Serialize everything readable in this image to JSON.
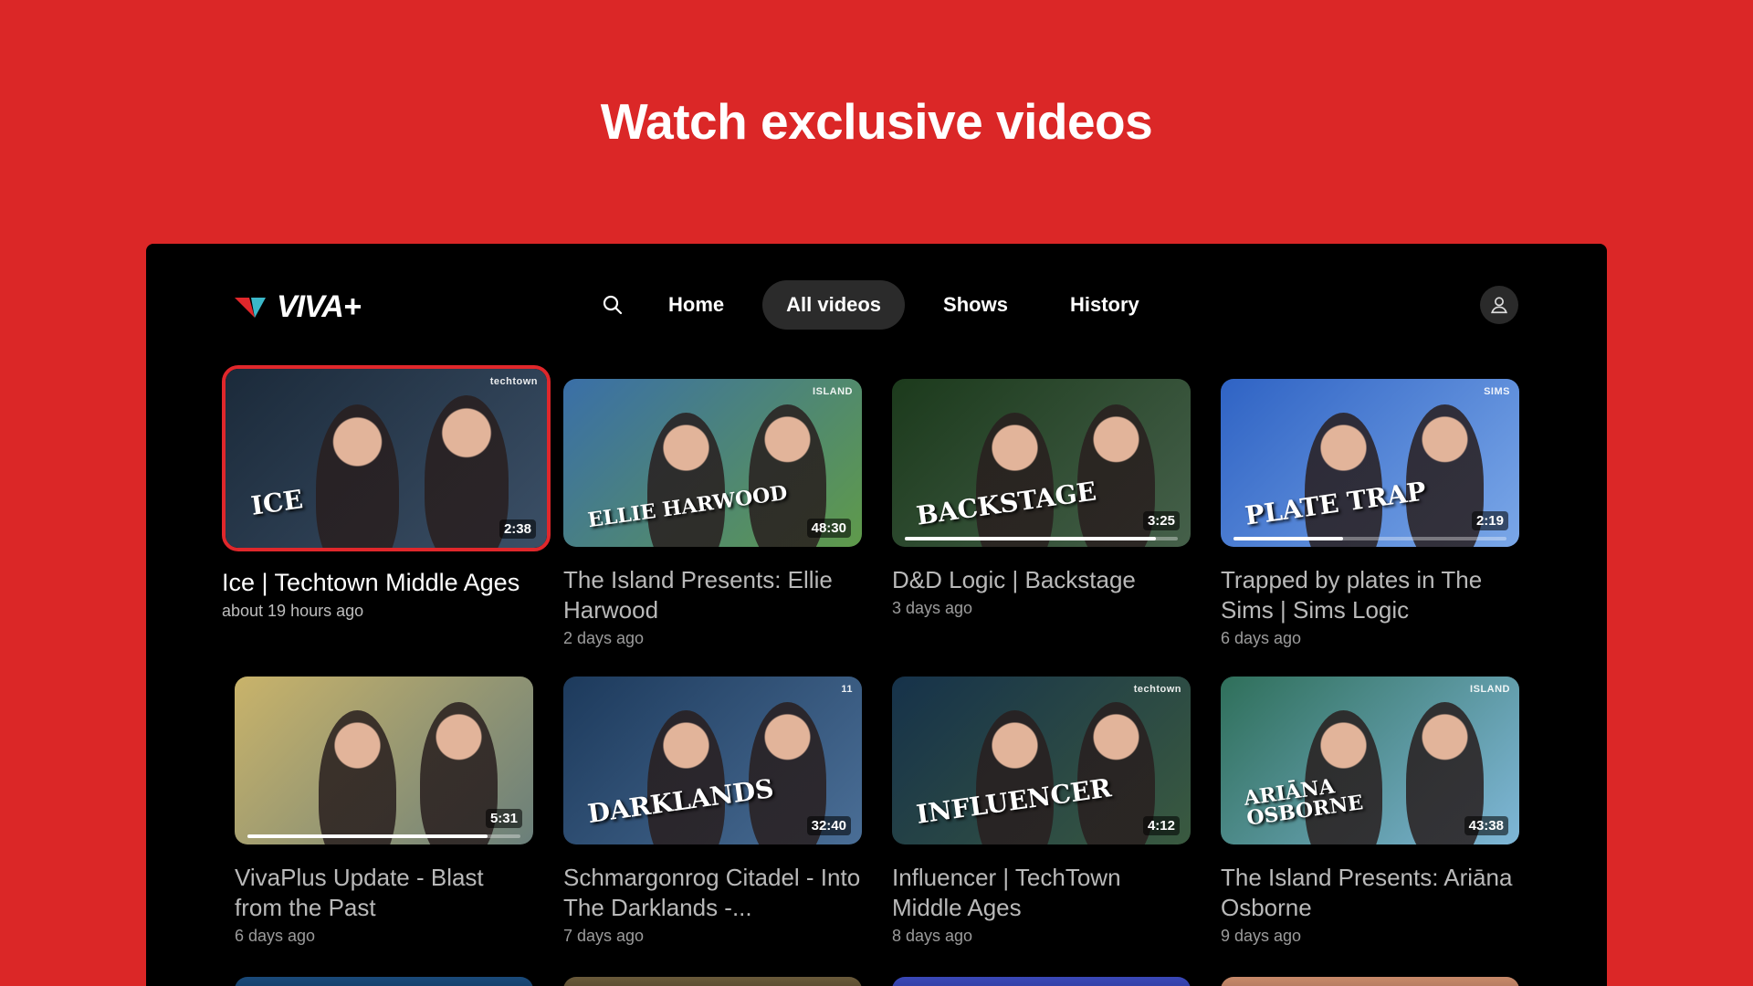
{
  "headline": "Watch exclusive videos",
  "app": {
    "logo_text": "VIVA+"
  },
  "nav": {
    "search_icon": "search-icon",
    "items": [
      {
        "label": "Home",
        "active": false
      },
      {
        "label": "All videos",
        "active": true
      },
      {
        "label": "Shows",
        "active": false
      },
      {
        "label": "History",
        "active": false
      }
    ],
    "profile_icon": "user-icon"
  },
  "videos": [
    {
      "title": "Ice | Techtown Middle Ages",
      "meta": "about 19 hours ago",
      "duration": "2:38",
      "overlay": "ICE",
      "brand": "techtown",
      "progress": 0,
      "colors": [
        "#1b2a3a",
        "#3b4f66"
      ]
    },
    {
      "title": "The Island Presents: Ellie Harwood",
      "meta": "2 days ago",
      "duration": "48:30",
      "overlay": "ELLIE HARWOOD",
      "brand": "ISLAND",
      "progress": 0,
      "colors": [
        "#3a6fa8",
        "#5f9a4a"
      ]
    },
    {
      "title": "D&D Logic | Backstage",
      "meta": "3 days ago",
      "duration": "3:25",
      "overlay": "BACKSTAGE",
      "brand": "",
      "progress": 0.92,
      "colors": [
        "#1c3a1c",
        "#45604a"
      ]
    },
    {
      "title": "Trapped by plates in The Sims | Sims Logic",
      "meta": "6 days ago",
      "duration": "2:19",
      "overlay": "PLATE TRAP",
      "brand": "SIMS",
      "progress": 0.4,
      "colors": [
        "#2f63c4",
        "#7aa7e8"
      ]
    },
    {
      "title": "VivaPlus Update - Blast from the Past",
      "meta": "6 days ago",
      "duration": "5:31",
      "overlay": "",
      "brand": "",
      "progress": 0.88,
      "colors": [
        "#c9b36a",
        "#6a7f7a"
      ]
    },
    {
      "title": "Schmargonrog Citadel - Into The Darklands -...",
      "meta": "7 days ago",
      "duration": "32:40",
      "overlay": "DARKLANDS",
      "brand": "11",
      "progress": 0,
      "colors": [
        "#1d3a5c",
        "#4a6e96"
      ]
    },
    {
      "title": "Influencer | TechTown Middle Ages",
      "meta": "8 days ago",
      "duration": "4:12",
      "overlay": "INFLUENCER",
      "brand": "techtown",
      "progress": 0,
      "colors": [
        "#16324a",
        "#3a5a40"
      ]
    },
    {
      "title": "The Island Presents: Ariāna Osborne",
      "meta": "9 days ago",
      "duration": "43:38",
      "overlay": "ARIĀNA OSBORNE",
      "brand": "ISLAND",
      "progress": 0,
      "colors": [
        "#2f6f5a",
        "#7fb7d8"
      ]
    }
  ],
  "colors": {
    "brand_red": "#DB2727",
    "focus_border": "#E0272B"
  }
}
